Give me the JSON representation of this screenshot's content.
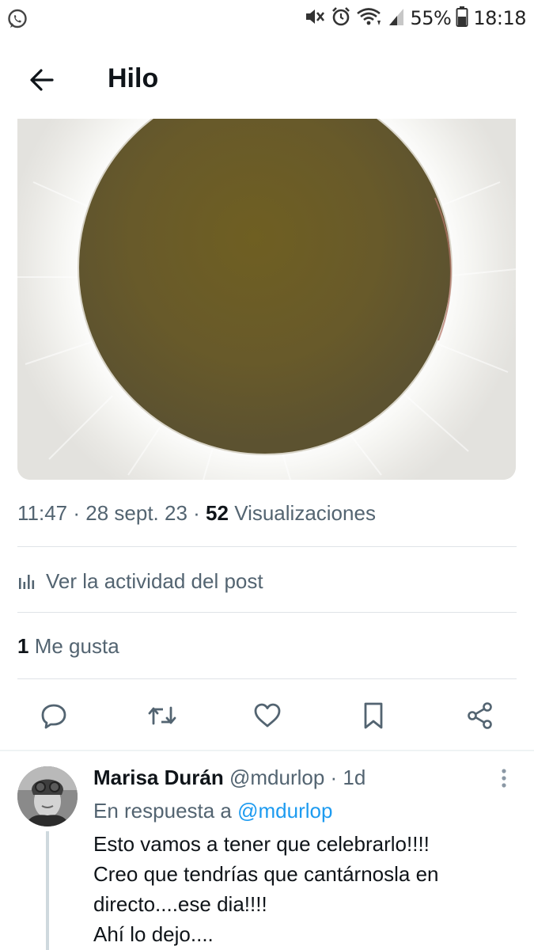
{
  "status_bar": {
    "battery": "55%",
    "time": "18:18",
    "icons": [
      "whatsapp-icon",
      "mute-icon",
      "alarm-icon",
      "wifi-icon",
      "signal-icon",
      "battery-icon"
    ]
  },
  "header": {
    "title": "Hilo",
    "back_icon": "arrow-left-icon"
  },
  "post": {
    "media_description_icon": "solar-eclipse-photo",
    "time": "11:47",
    "date": "28 sept. 23",
    "views_count": "52",
    "views_label": "Visualizaciones",
    "activity_label": "Ver la actividad del post",
    "likes_count": "1",
    "likes_label": "Me gusta",
    "actions": [
      "reply-icon",
      "retweet-icon",
      "like-icon",
      "bookmark-icon",
      "share-icon"
    ]
  },
  "reply": {
    "name": "Marisa Durán",
    "handle": "@mdurlop",
    "age": "1d",
    "in_reply_prefix": "En respuesta a",
    "in_reply_handle": "@mdurlop",
    "lines": [
      "Esto vamos a tener que celebrarlo!!!!",
      "Creo que tendrías que cantárnosla en",
      "directo....ese dia!!!!",
      "Ahí lo dejo...."
    ]
  },
  "colors": {
    "text": "#0f1419",
    "secondary": "#536471",
    "accent": "#1d9bf0",
    "divider": "#dfe3e7"
  }
}
